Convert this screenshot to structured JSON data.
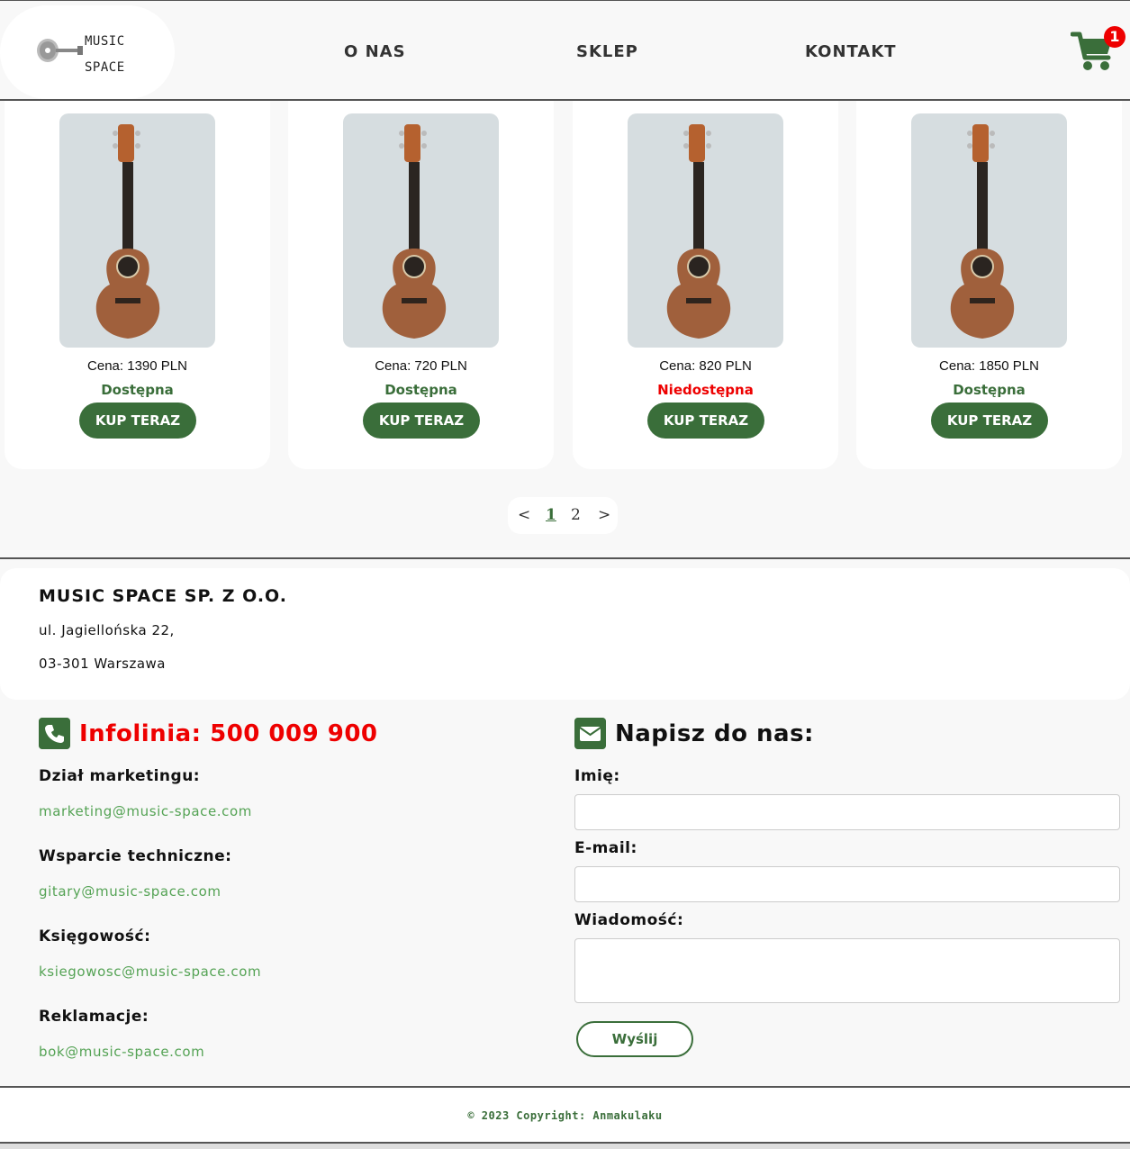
{
  "header": {
    "logo_line1": "MUSIC",
    "logo_line2": "SPACE",
    "nav": [
      "O NAS",
      "SKLEP",
      "KONTAKT"
    ],
    "cart_icon": "cart-icon",
    "cart_count": "1"
  },
  "products": [
    {
      "price": "Cena: 1390 PLN",
      "availability": "Dostępna",
      "available": true,
      "button": "KUP TERAZ"
    },
    {
      "price": "Cena: 720 PLN",
      "availability": "Dostępna",
      "available": true,
      "button": "KUP TERAZ"
    },
    {
      "price": "Cena: 820 PLN",
      "availability": "Niedostępna",
      "available": false,
      "button": "KUP TERAZ"
    },
    {
      "price": "Cena: 1850 PLN",
      "availability": "Dostępna",
      "available": true,
      "button": "KUP TERAZ"
    }
  ],
  "pagination": {
    "prev": "<",
    "pages": [
      "1",
      "2"
    ],
    "current": "1",
    "next": ">"
  },
  "company": {
    "name": "MUSIC SPACE SP. Z O.O.",
    "address_line1": "ul. Jagiellońska 22,",
    "address_line2": "03-301 Warszawa"
  },
  "contacts": {
    "infolinia": "Infolinia: 500 009 900",
    "departments": [
      {
        "label": "Dział marketingu:",
        "email": "marketing@music-space.com"
      },
      {
        "label": "Wsparcie techniczne:",
        "email": "gitary@music-space.com"
      },
      {
        "label": "Księgowość:",
        "email": "ksiegowosc@music-space.com"
      },
      {
        "label": "Reklamacje:",
        "email": "bok@music-space.com"
      }
    ]
  },
  "form": {
    "title": "Napisz do nas:",
    "name_label": "Imię:",
    "email_label": "E-mail:",
    "message_label": "Wiadomość:",
    "send_label": "Wyślij"
  },
  "footer": {
    "copyright": "© 2023 Copyright: Anmakulaku"
  },
  "colors": {
    "accent": "#3a6e3a",
    "available": "#3a6e3a",
    "unavailable": "#e00000",
    "link": "#55a355"
  }
}
